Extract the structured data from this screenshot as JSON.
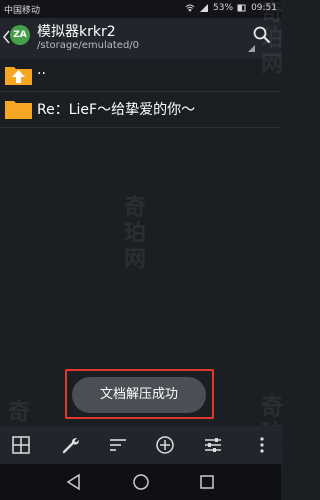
{
  "status_bar": {
    "carrier": "中国移动",
    "battery": "53%",
    "time": "09:51"
  },
  "header": {
    "app_icon_text": "ZA",
    "title": "模拟器krkr2",
    "path": "/storage/emulated/0"
  },
  "files": [
    {
      "name": "..",
      "type": "parent-folder"
    },
    {
      "name": "Re：LieF～给挚爱的你～",
      "type": "folder"
    }
  ],
  "toast": {
    "message": "文档解压成功"
  },
  "watermark": "奇珀网",
  "toolbar": {
    "items": [
      "grid-view-icon",
      "wrench-icon",
      "sort-icon",
      "add-icon",
      "settings-sliders-icon",
      "more-icon"
    ]
  },
  "nav": {
    "items": [
      "back-nav-icon",
      "home-nav-icon",
      "recents-nav-icon"
    ]
  },
  "colors": {
    "folder": "#f5a623",
    "accent_red": "#e23a2a",
    "app_icon": "#46a049"
  }
}
